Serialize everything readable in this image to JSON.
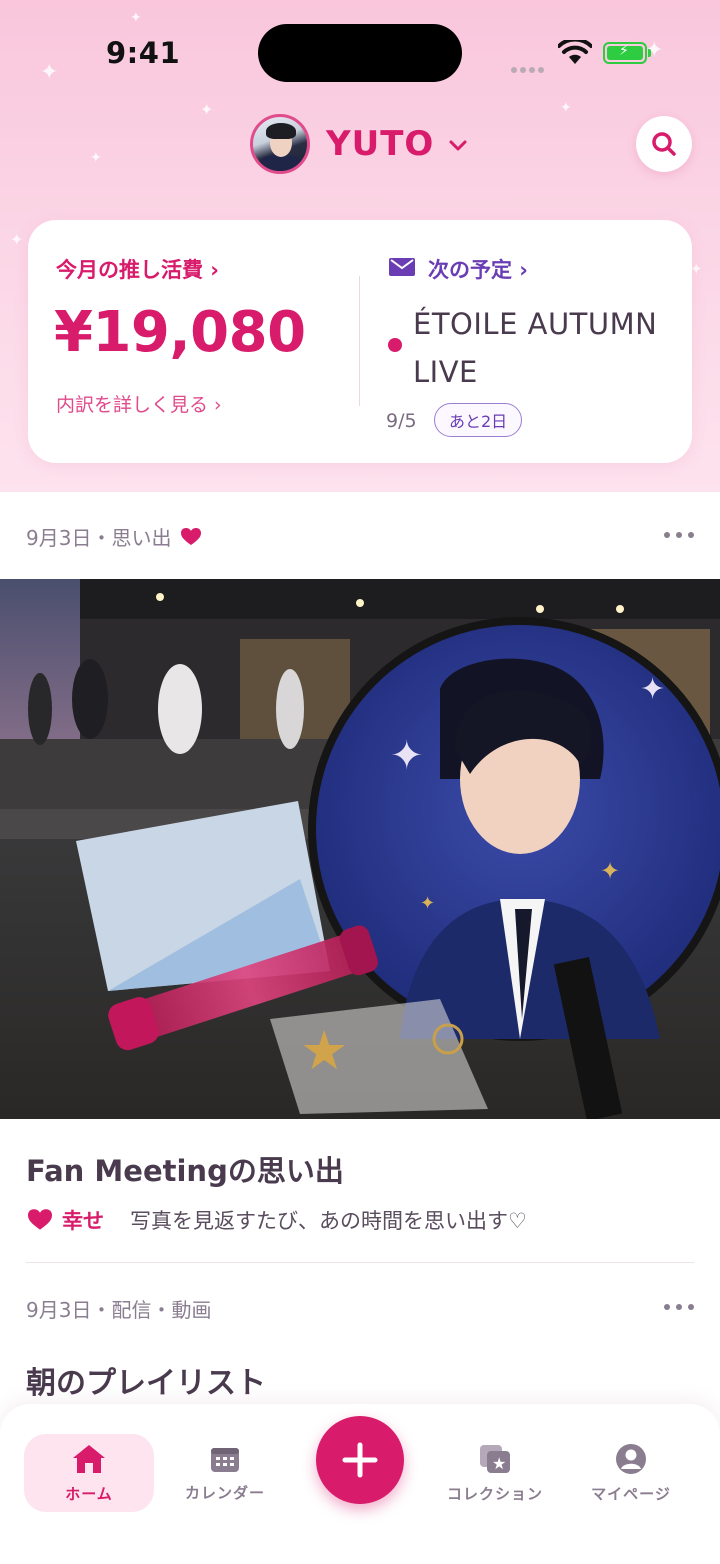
{
  "status_bar": {
    "time": "9:41"
  },
  "profile": {
    "name": "YUTO"
  },
  "spend": {
    "title": "今月の推し活費 ›",
    "amount": "¥19,080",
    "detail_link": "内訳を詳しく見る ›"
  },
  "next_event": {
    "title": "次の予定 ›",
    "name": "ÉTOILE AUTUMN LIVE",
    "date": "9/5",
    "countdown": "あと2日"
  },
  "post1": {
    "date": "9月3日・思い出",
    "title": "Fan Meetingの思い出",
    "mood": "幸せ",
    "caption": "写真を見返すたび、あの時間を思い出す♡"
  },
  "post2": {
    "date": "9月3日・配信・動画",
    "title": "朝のプレイリスト"
  },
  "tabbar": {
    "home": "ホーム",
    "calendar": "カレンダー",
    "collection": "コレクション",
    "mypage": "マイページ"
  },
  "colors": {
    "accent": "#d81b6a",
    "purple": "#6a3db4",
    "header_bg": "#fbd5e5"
  },
  "icons": [
    "search-icon",
    "mail-icon",
    "heart-icon",
    "home-icon",
    "calendar-icon",
    "plus-icon",
    "collection-icon",
    "user-icon"
  ]
}
